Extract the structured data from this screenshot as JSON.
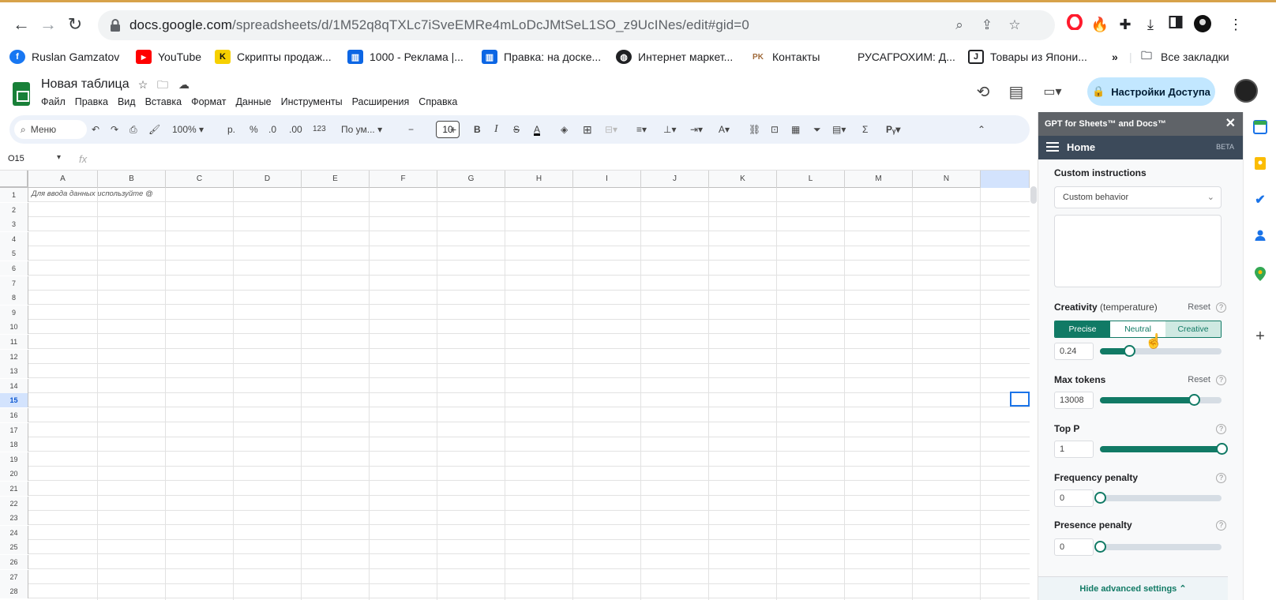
{
  "browser": {
    "url_host": "docs.google.com",
    "url_path": "/spreadsheets/d/1M52q8qTXLc7iSveEMRe4mLoDcJMtSeL1SO_z9UcINes/edit#gid=0",
    "bookmarks": [
      {
        "label": "Ruslan Gamzatov",
        "icon": "facebook-icon",
        "color": "#1877f2",
        "glyph": "f"
      },
      {
        "label": "YouTube",
        "icon": "youtube-icon",
        "color": "#ff0000",
        "glyph": "▶"
      },
      {
        "label": "Скрипты продаж...",
        "icon": "k-logo-icon",
        "color": "#f6d000",
        "glyph": "K"
      },
      {
        "label": "1000 - Реклама |...",
        "icon": "trello-icon",
        "color": "#0c66e4",
        "glyph": "▥"
      },
      {
        "label": "Правка: на доске...",
        "icon": "trello-icon",
        "color": "#0c66e4",
        "glyph": "▥"
      },
      {
        "label": "Интернет маркет...",
        "icon": "globe-icon",
        "color": "#202124",
        "glyph": "◍"
      },
      {
        "label": "Контакты",
        "icon": "pk-logo-icon",
        "color": "#ffffff",
        "glyph": "PK"
      },
      {
        "label": "РУСАГРОХИМ: Д...",
        "icon": "",
        "color": "#ffffff",
        "glyph": ""
      },
      {
        "label": "Товары из Япони...",
        "icon": "j-logo-icon",
        "color": "#202124",
        "glyph": "J"
      }
    ],
    "more_bookmarks": "»",
    "all_bookmarks": "Все закладки"
  },
  "sheet": {
    "title": "Новая таблица",
    "menu": [
      "Файл",
      "Правка",
      "Вид",
      "Вставка",
      "Формат",
      "Данные",
      "Инструменты",
      "Расширения",
      "Справка"
    ],
    "share_label": "Настройки Доступа",
    "toolbar": {
      "menu_label": "Меню",
      "zoom": "100%",
      "currency": "р.",
      "percent": "%",
      "dec_decrease": ".0",
      "dec_increase": ".00",
      "number_format": "123",
      "font": "По ум...",
      "font_size": "10"
    },
    "cell_ref": "O15",
    "fx": "fx",
    "columns": [
      "A",
      "B",
      "C",
      "D",
      "E",
      "F",
      "G",
      "H",
      "I",
      "J",
      "K",
      "L",
      "M",
      "N"
    ],
    "rows": [
      "1",
      "2",
      "3",
      "4",
      "5",
      "6",
      "7",
      "8",
      "9",
      "10",
      "11",
      "12",
      "13",
      "14",
      "15",
      "16",
      "17",
      "18",
      "19",
      "20",
      "21",
      "22",
      "23",
      "24",
      "25",
      "26",
      "27",
      "28"
    ],
    "selected_row": "15",
    "a1_hint": "Для ввода данных используйте @"
  },
  "panel": {
    "title": "GPT for Sheets™ and Docs™",
    "nav_home": "Home",
    "nav_beta": "BETA",
    "custom_instructions_label": "Custom instructions",
    "custom_behavior_value": "Custom behavior",
    "creativity_label": "Creativity",
    "creativity_sub": "(temperature)",
    "reset_label": "Reset",
    "creativity_options": [
      "Precise",
      "Neutral",
      "Creative"
    ],
    "creativity_selected": "Precise",
    "temperature_value": "0.24",
    "temperature_fraction": 0.24,
    "max_tokens_label": "Max tokens",
    "max_tokens_value": "13008",
    "max_tokens_fraction": 0.77,
    "top_p_label": "Top P",
    "top_p_value": "1",
    "top_p_fraction": 1.0,
    "frequency_label": "Frequency penalty",
    "frequency_value": "0",
    "frequency_fraction": 0.0,
    "presence_label": "Presence penalty",
    "presence_value": "0",
    "presence_fraction": 0.0,
    "hide_advanced": "Hide advanced settings ⌃"
  },
  "colors": {
    "accent": "#117a65",
    "share_bg": "#c2e7ff",
    "sheets_green": "#188038"
  }
}
